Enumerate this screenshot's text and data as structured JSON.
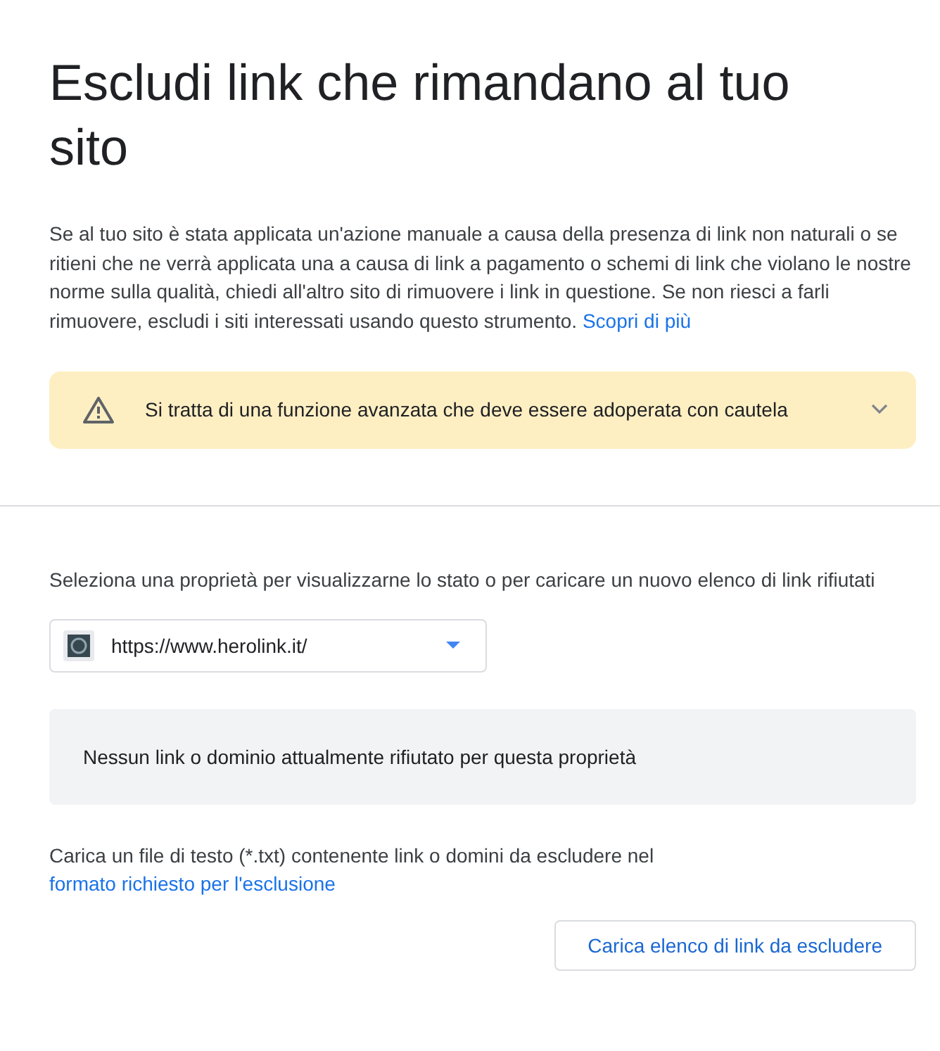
{
  "title": "Escludi link che rimandano al tuo sito",
  "intro": {
    "text": "Se al tuo sito è stata applicata un'azione manuale a causa della presenza di link non naturali o se ritieni che ne verrà applicata una a causa di link a pagamento o schemi di link che violano le nostre norme sulla qualità, chiedi all'altro sito di rimuovere i link in questione. Se non riesci a farli rimuovere, escludi i siti interessati usando questo strumento.",
    "link": "Scopri di più"
  },
  "warning": {
    "text": "Si tratta di una funzione avanzata che deve essere adoperata con cautela",
    "expanded": false
  },
  "property_prompt": "Seleziona una proprietà per visualizzarne lo stato o per caricare un nuovo elenco di link rifiutati",
  "property_select": {
    "value": "https://www.herolink.it/"
  },
  "status_message": "Nessun link o dominio attualmente rifiutato per questa proprietà",
  "upload_hint": {
    "text": "Carica un file di testo (*.txt) contenente link o domini da escludere nel",
    "link": "formato richiesto per l'esclusione"
  },
  "upload_button": "Carica elenco di link da escludere"
}
